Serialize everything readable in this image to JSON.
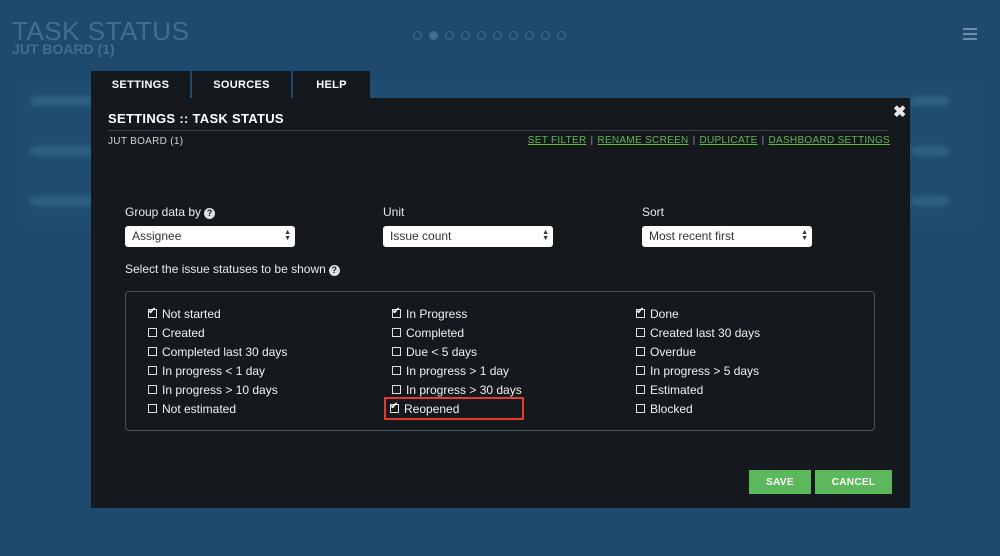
{
  "background": {
    "title": "TASK STATUS",
    "subtitle": "JUT BOARD (1)",
    "page_dots": 10,
    "active_dot": 1
  },
  "tabs": [
    {
      "label": "SETTINGS"
    },
    {
      "label": "SOURCES"
    },
    {
      "label": "HELP"
    }
  ],
  "modal": {
    "title": "SETTINGS :: TASK STATUS",
    "board": "JUT BOARD (1)",
    "close": "✖",
    "links": {
      "set_filter": "SET FILTER",
      "rename_screen": "RENAME SCREEN",
      "duplicate": "DUPLICATE",
      "dashboard_settings": "DASHBOARD SETTINGS",
      "separator": "|"
    },
    "group_by": {
      "label": "Group data by",
      "value": "Assignee"
    },
    "unit": {
      "label": "Unit",
      "value": "Issue count"
    },
    "sort": {
      "label": "Sort",
      "value": "Most recent first"
    },
    "help_glyph": "?",
    "instructions": "Select the issue statuses to be shown",
    "statuses": {
      "col1": [
        {
          "label": "Not started",
          "checked": true
        },
        {
          "label": "Created",
          "checked": false
        },
        {
          "label": "Completed last 30 days",
          "checked": false
        },
        {
          "label": "In progress < 1 day",
          "checked": false
        },
        {
          "label": "In progress > 10 days",
          "checked": false
        },
        {
          "label": "Not estimated",
          "checked": false
        }
      ],
      "col2": [
        {
          "label": "In Progress",
          "checked": true
        },
        {
          "label": "Completed",
          "checked": false
        },
        {
          "label": "Due < 5 days",
          "checked": false
        },
        {
          "label": "In progress > 1 day",
          "checked": false
        },
        {
          "label": "In progress > 30 days",
          "checked": false
        },
        {
          "label": "Reopened",
          "checked": true
        }
      ],
      "col3": [
        {
          "label": "Done",
          "checked": true
        },
        {
          "label": "Created last 30 days",
          "checked": false
        },
        {
          "label": "Overdue",
          "checked": false
        },
        {
          "label": "In progress > 5 days",
          "checked": false
        },
        {
          "label": "Estimated",
          "checked": false
        },
        {
          "label": "Blocked",
          "checked": false
        }
      ]
    },
    "save_label": "SAVE",
    "cancel_label": "CANCEL"
  },
  "colors": {
    "background": "#1d4a6e",
    "modal": "#15191d",
    "link": "#5fb94a",
    "button": "#5cb85c",
    "highlight": "#e33c2e"
  }
}
